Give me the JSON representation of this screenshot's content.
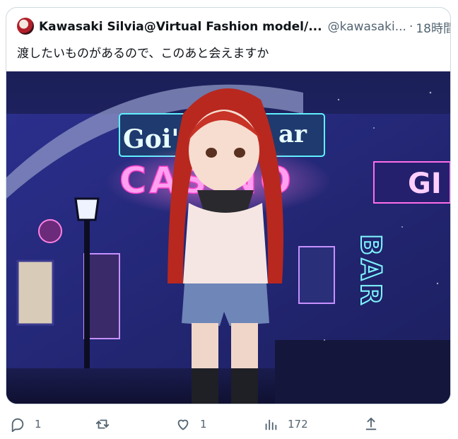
{
  "tweet": {
    "display_name": "Kawasaki Silvia@Virtual Fashion model/...",
    "handle": "@kawasaki...",
    "separator": "·",
    "time": "18時間",
    "text": "渡したいものがあるので、このあと会えますか"
  },
  "media": {
    "description_icons": [
      "neon-casino-sign",
      "neon-bar-sign",
      "street-lamp"
    ],
    "neon_sign_1": "Goi's",
    "neon_sign_1b": "ar",
    "neon_sign_2": "CASINO",
    "neon_sign_3": "GI",
    "neon_sign_4": "BAR"
  },
  "actions": {
    "reply_count": "1",
    "like_count": "1",
    "view_count": "172"
  },
  "colors": {
    "accent": "#1d9bf0",
    "muted": "#536471",
    "border": "#cfd9de"
  }
}
